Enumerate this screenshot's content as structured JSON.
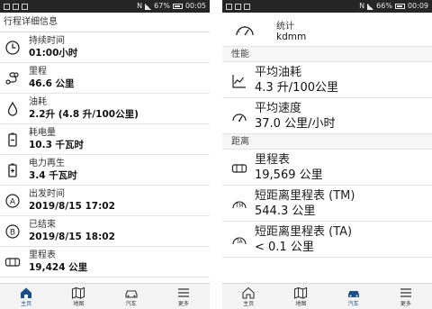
{
  "left": {
    "status": {
      "time": "00:05",
      "battery": "67%"
    },
    "header": "行程详细信息",
    "rows": [
      {
        "label": "持续时间",
        "value": "01:00小时",
        "icon": "clock-icon"
      },
      {
        "label": "里程",
        "value": "46.6 公里",
        "icon": "route-icon"
      },
      {
        "label": "油耗",
        "value": "2.2升 (4.8 升/100公里)",
        "icon": "fuel-drop-icon"
      },
      {
        "label": "耗电量",
        "value": "10.3 千瓦时",
        "icon": "battery-minus-icon"
      },
      {
        "label": "电力再生",
        "value": "3.4 千瓦时",
        "icon": "battery-plus-icon"
      },
      {
        "label": "出发时间",
        "value": "2019/8/15 17:02",
        "icon": "circle-a-icon"
      },
      {
        "label": "已结束",
        "value": "2019/8/15 18:02",
        "icon": "circle-b-icon"
      },
      {
        "label": "里程表",
        "value": "19,424 公里",
        "icon": "odometer-icon"
      }
    ],
    "tabs": [
      {
        "label": "主页",
        "icon": "home-icon"
      },
      {
        "label": "地图",
        "icon": "map-icon"
      },
      {
        "label": "汽车",
        "icon": "car-icon"
      },
      {
        "label": "更多",
        "icon": "menu-icon"
      }
    ]
  },
  "right": {
    "status": {
      "time": "00:09",
      "battery": "66%"
    },
    "top": {
      "label": "统计",
      "value": "kdmm",
      "icon": "gauge-icon"
    },
    "section_performance": "性能",
    "perf_rows": [
      {
        "label": "平均油耗",
        "value": "4.3 升/100公里",
        "icon": "chart-line-icon"
      },
      {
        "label": "平均速度",
        "value": "37.0 公里/小时",
        "icon": "speedometer-icon"
      }
    ],
    "section_distance": "距离",
    "dist_rows": [
      {
        "label": "里程表",
        "value": "19,569 公里",
        "icon": "odometer-icon"
      },
      {
        "label": "短距离里程表 (TM)",
        "value": "544.3 公里",
        "icon": "trip-tm-icon"
      },
      {
        "label": "短距离里程表 (TA)",
        "value": "< 0.1 公里",
        "icon": "trip-ta-icon"
      }
    ],
    "tabs": [
      {
        "label": "主页",
        "icon": "home-icon"
      },
      {
        "label": "地图",
        "icon": "map-icon"
      },
      {
        "label": "汽车",
        "icon": "car-icon"
      },
      {
        "label": "更多",
        "icon": "menu-icon"
      }
    ]
  },
  "colors": {
    "accent": "#1a4f8a",
    "statusbar": "#262626"
  }
}
